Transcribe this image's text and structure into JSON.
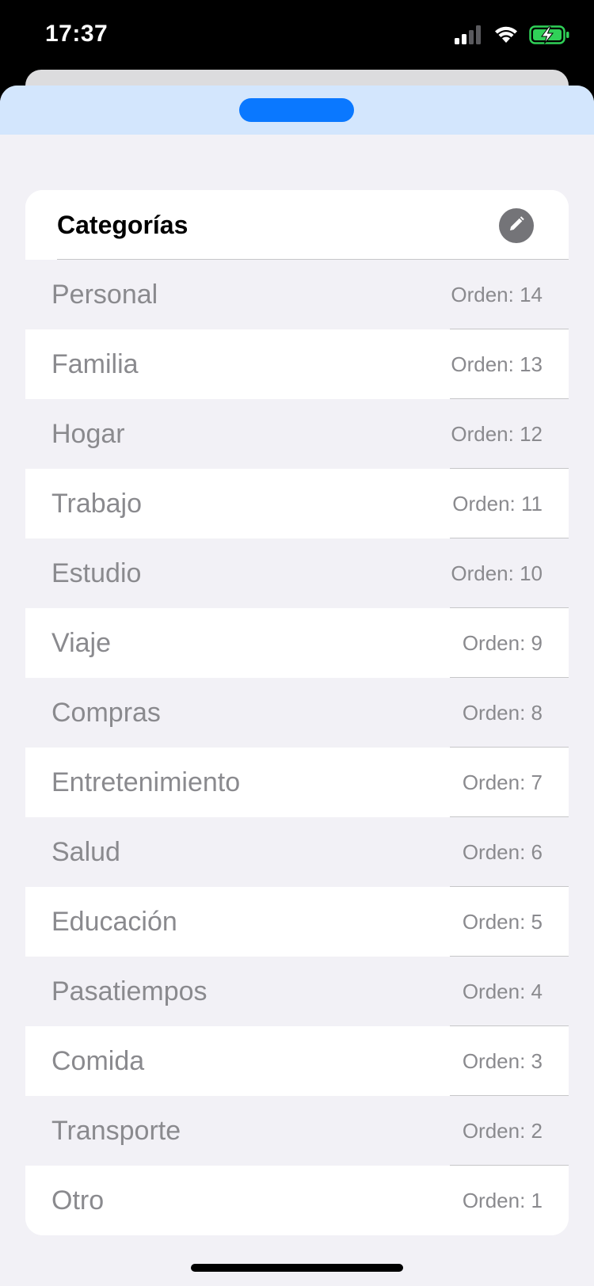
{
  "status_bar": {
    "time": "17:37",
    "icons": [
      "signal-icon",
      "wifi-icon",
      "battery-charging-icon"
    ],
    "battery_color": "#30d158"
  },
  "sheet": {
    "accent": "#0a78ff",
    "header_color": "#d3e6fd"
  },
  "card": {
    "title": "Categorías",
    "edit_icon": "pencil-icon",
    "rows": [
      {
        "label": "Personal",
        "order": "Orden: 14"
      },
      {
        "label": "Familia",
        "order": "Orden: 13"
      },
      {
        "label": "Hogar",
        "order": "Orden: 12"
      },
      {
        "label": "Trabajo",
        "order": "Orden: 11"
      },
      {
        "label": "Estudio",
        "order": "Orden: 10"
      },
      {
        "label": "Viaje",
        "order": "Orden: 9"
      },
      {
        "label": "Compras",
        "order": "Orden: 8"
      },
      {
        "label": "Entretenimiento",
        "order": "Orden: 7"
      },
      {
        "label": "Salud",
        "order": "Orden: 6"
      },
      {
        "label": "Educación",
        "order": "Orden: 5"
      },
      {
        "label": "Pasatiempos",
        "order": "Orden: 4"
      },
      {
        "label": "Comida",
        "order": "Orden: 3"
      },
      {
        "label": "Transporte",
        "order": "Orden: 2"
      },
      {
        "label": "Otro",
        "order": "Orden: 1"
      }
    ]
  }
}
